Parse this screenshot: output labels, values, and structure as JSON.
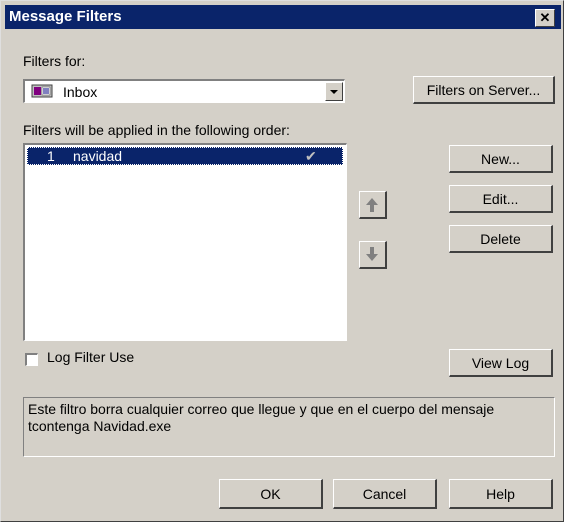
{
  "window": {
    "title": "Message Filters"
  },
  "filters_for": {
    "label": "Filters for:",
    "selected": "Inbox",
    "icon": "inbox-icon"
  },
  "buttons": {
    "filters_on_server": "Filters on Server...",
    "new": "New...",
    "edit": "Edit...",
    "delete": "Delete",
    "view_log": "View Log",
    "ok": "OK",
    "cancel": "Cancel",
    "help": "Help"
  },
  "order_label": "Filters will be applied in the following order:",
  "filters": [
    {
      "number": "1",
      "name": "navidad",
      "enabled": true
    }
  ],
  "log_filter_use": {
    "label": "Log Filter Use",
    "checked": false
  },
  "description": "Este filtro borra cualquier correo que llegue y que en el cuerpo del mensaje tcontenga Navidad.exe",
  "colors": {
    "title_bar": "#0a246a",
    "selection": "#0a246a",
    "face": "#d4d0c8"
  }
}
